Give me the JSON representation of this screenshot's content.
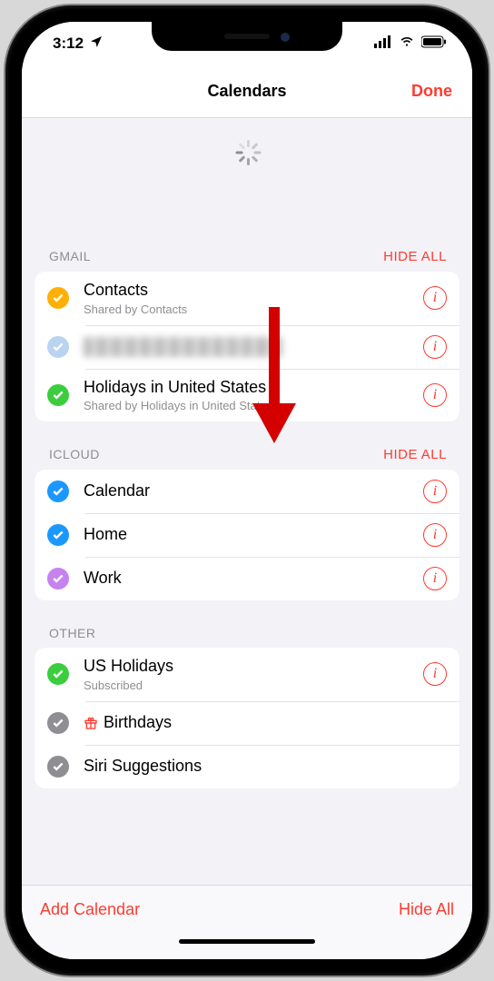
{
  "status": {
    "time": "3:12",
    "location_icon": "location-arrow"
  },
  "nav": {
    "title": "Calendars",
    "done": "Done"
  },
  "colors": {
    "tint": "#ff3b30",
    "orange": "#ffb007",
    "lightblue": "#b8d4f0",
    "green": "#3ccd3e",
    "blue": "#1b98ff",
    "purple": "#c583ef",
    "gray": "#8e8e93"
  },
  "sections": [
    {
      "id": "gmail",
      "header": "GMAIL",
      "hide": "HIDE ALL",
      "items": [
        {
          "title": "Contacts",
          "sub": "Shared by Contacts",
          "color": "orange",
          "info": true,
          "blurred": false
        },
        {
          "title": "",
          "sub": "",
          "color": "lightblue",
          "info": true,
          "blurred": true
        },
        {
          "title": "Holidays in United States",
          "sub": "Shared by Holidays in United States",
          "color": "green",
          "info": true,
          "blurred": false
        }
      ]
    },
    {
      "id": "icloud",
      "header": "ICLOUD",
      "hide": "HIDE ALL",
      "items": [
        {
          "title": "Calendar",
          "color": "blue",
          "info": true
        },
        {
          "title": "Home",
          "color": "blue",
          "info": true
        },
        {
          "title": "Work",
          "color": "purple",
          "info": true
        }
      ]
    },
    {
      "id": "other",
      "header": "OTHER",
      "hide": "",
      "items": [
        {
          "title": "US Holidays",
          "sub": "Subscribed",
          "color": "green",
          "info": true
        },
        {
          "title": "Birthdays",
          "color": "gray",
          "info": false,
          "gift": true
        },
        {
          "title": "Siri Suggestions",
          "color": "gray",
          "info": false
        }
      ]
    }
  ],
  "toolbar": {
    "add": "Add Calendar",
    "hide_all": "Hide All"
  }
}
